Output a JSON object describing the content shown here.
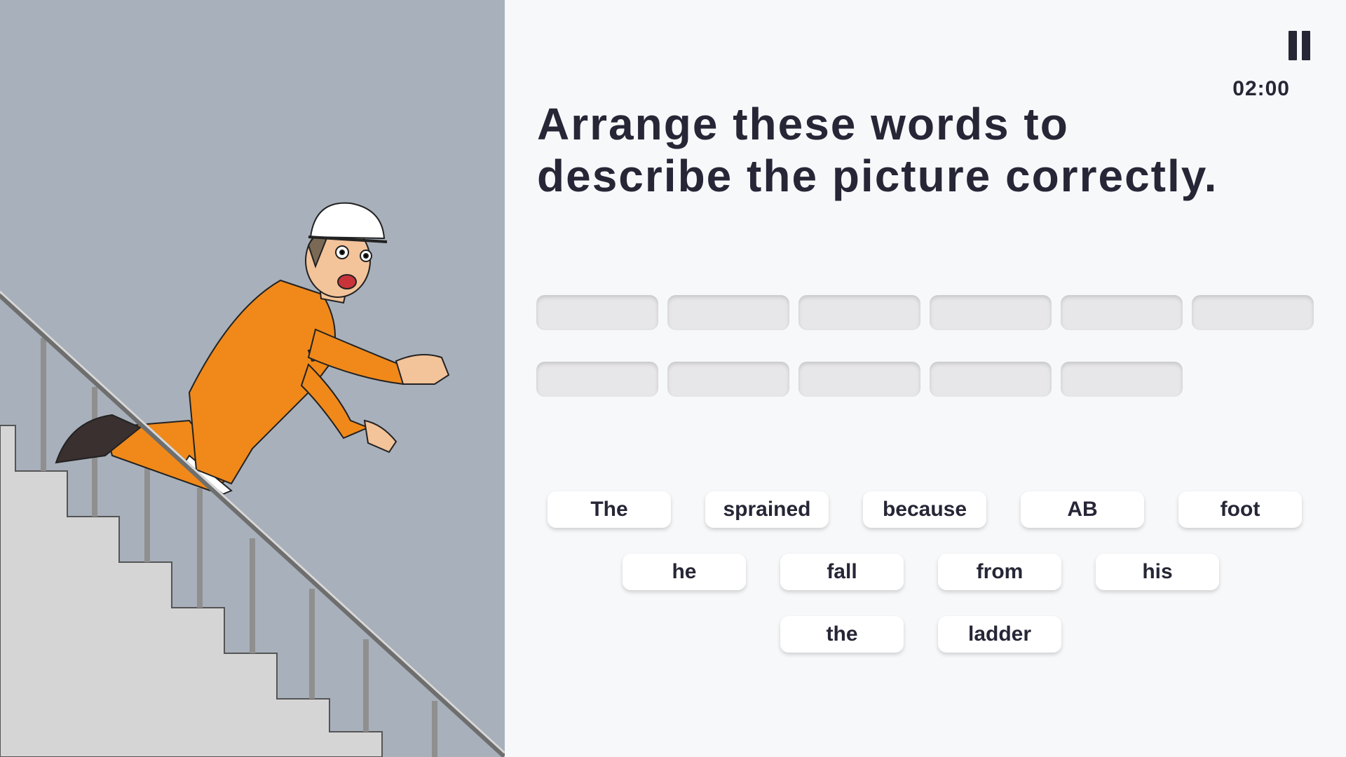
{
  "timer": "02:00",
  "prompt": {
    "line1": "Arrange these words to",
    "line2": "describe the picture correctly."
  },
  "answer_slots": {
    "count": 11
  },
  "word_bank": [
    "The",
    "sprained",
    "because",
    "AB",
    "foot",
    "he",
    "fall",
    "from",
    "his",
    "the",
    "ladder"
  ],
  "icons": {
    "pause": "pause-icon"
  },
  "colors": {
    "text": "#262636",
    "illustration_bg": "#a8b0bb",
    "panel_bg": "#f7f8fa",
    "slot": "#e7e7e9",
    "chip": "#ffffff",
    "coverall": "#f0891a"
  }
}
